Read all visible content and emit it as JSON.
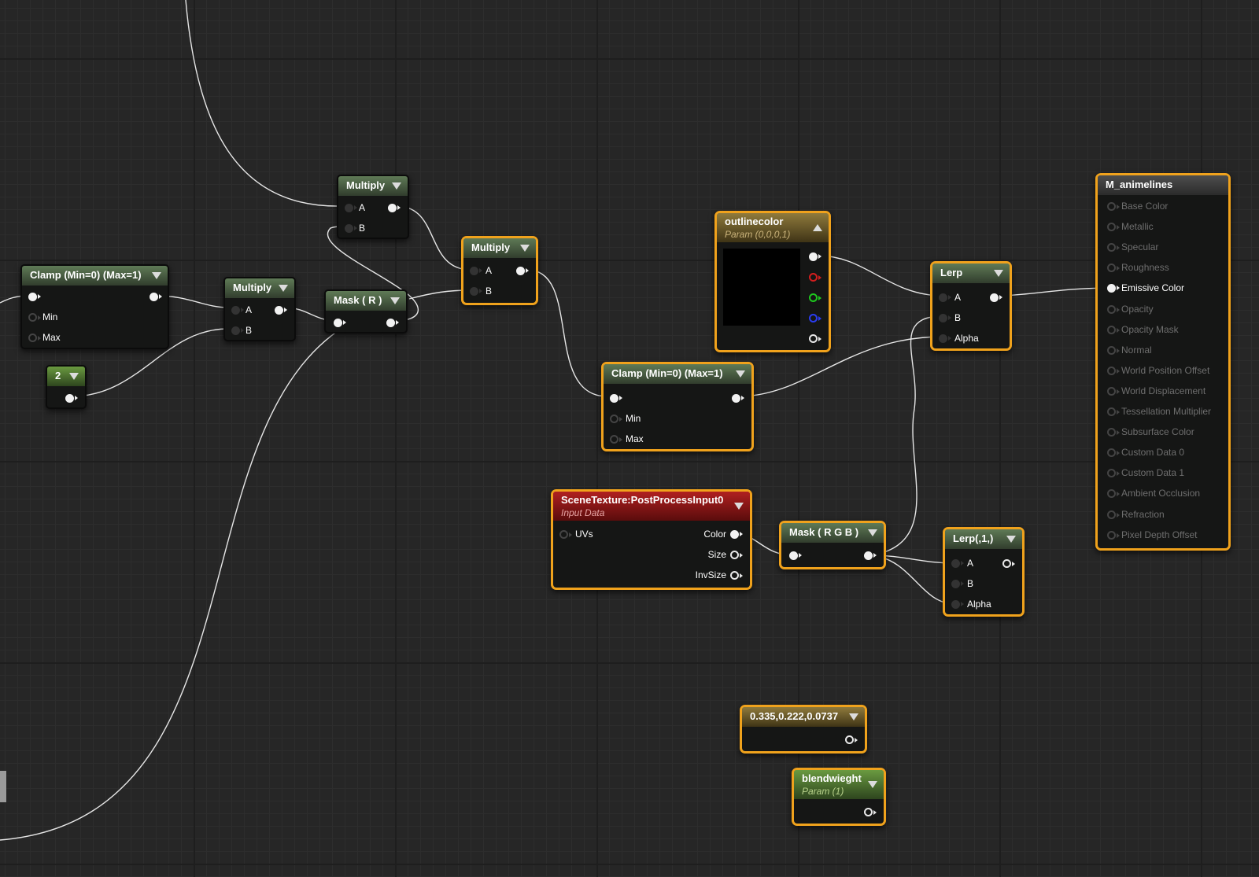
{
  "colors": {
    "selected_border": "#f0a21c",
    "param_color_swatch": "#000000",
    "wire": "#e6e6e6"
  },
  "nodes": {
    "clamp_left": {
      "title": "Clamp (Min=0) (Max=1)",
      "min": "Min",
      "max": "Max"
    },
    "const_2": {
      "title": "2"
    },
    "multiply_1": {
      "title": "Multiply",
      "a": "A",
      "b": "B"
    },
    "multiply_2": {
      "title": "Multiply",
      "a": "A",
      "b": "B"
    },
    "mask_r": {
      "title": "Mask ( R )"
    },
    "multiply_3": {
      "title": "Multiply",
      "a": "A",
      "b": "B"
    },
    "outlinecolor": {
      "title": "outlinecolor",
      "subtitle": "Param (0,0,0,1)"
    },
    "clamp_mid": {
      "title": "Clamp (Min=0) (Max=1)",
      "min": "Min",
      "max": "Max"
    },
    "lerp": {
      "title": "Lerp",
      "a": "A",
      "b": "B",
      "alpha": "Alpha"
    },
    "scene_texture": {
      "title": "SceneTexture:PostProcessInput0",
      "subtitle": "Input Data",
      "uvs": "UVs",
      "color": "Color",
      "size": "Size",
      "invsize": "InvSize"
    },
    "mask_rgb": {
      "title": "Mask ( R G B )"
    },
    "lerp_small": {
      "title": "Lerp(,1,)",
      "a": "A",
      "b": "B",
      "alpha": "Alpha"
    },
    "const_vec": {
      "title": "0.335,0.222,0.0737"
    },
    "blendwieght": {
      "title": "blendwieght",
      "subtitle": "Param (1)"
    }
  },
  "material": {
    "title": "M_animelines",
    "inputs": [
      {
        "label": "Base Color",
        "active": false
      },
      {
        "label": "Metallic",
        "active": false
      },
      {
        "label": "Specular",
        "active": false
      },
      {
        "label": "Roughness",
        "active": false
      },
      {
        "label": "Emissive Color",
        "active": true
      },
      {
        "label": "Opacity",
        "active": false
      },
      {
        "label": "Opacity Mask",
        "active": false
      },
      {
        "label": "Normal",
        "active": false
      },
      {
        "label": "World Position Offset",
        "active": false
      },
      {
        "label": "World Displacement",
        "active": false
      },
      {
        "label": "Tessellation Multiplier",
        "active": false
      },
      {
        "label": "Subsurface Color",
        "active": false
      },
      {
        "label": "Custom Data 0",
        "active": false
      },
      {
        "label": "Custom Data 1",
        "active": false
      },
      {
        "label": "Ambient Occlusion",
        "active": false
      },
      {
        "label": "Refraction",
        "active": false
      },
      {
        "label": "Pixel Depth Offset",
        "active": false
      }
    ]
  }
}
